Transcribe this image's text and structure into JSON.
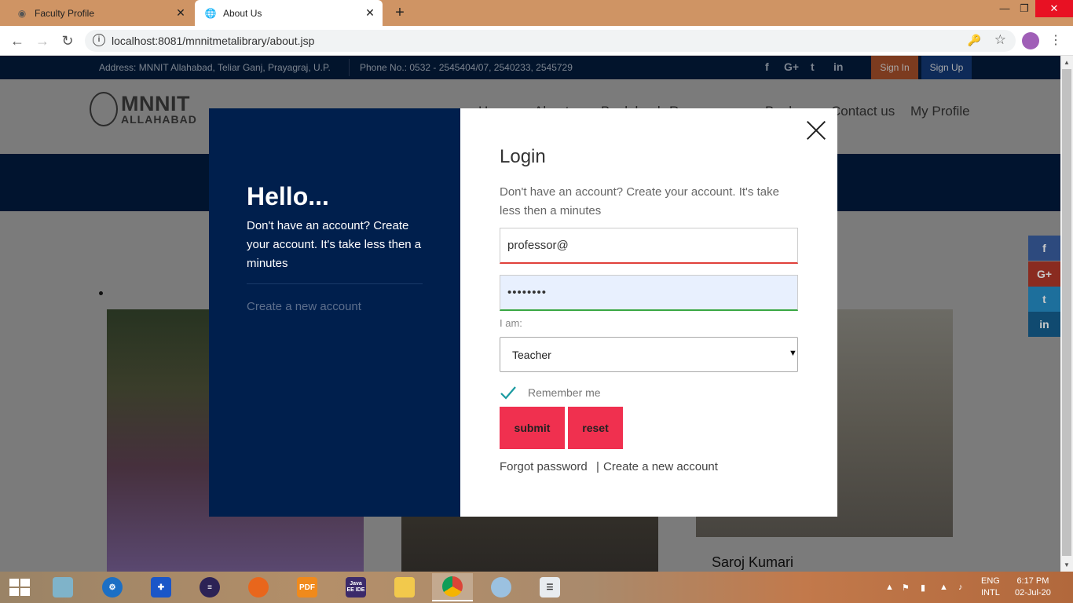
{
  "browser": {
    "tabs": [
      {
        "title": "Faculty Profile",
        "active": false
      },
      {
        "title": "About Us",
        "active": true
      }
    ],
    "new_tab_symbol": "+",
    "url": "localhost:8081/mnnitmetalibrary/about.jsp",
    "window_controls": {
      "minimize": "—",
      "maximize": "❐",
      "close": "✕"
    }
  },
  "site": {
    "top_strip": {
      "address": "Address: MNNIT Allahabad, Teliar Ganj, Prayagraj, U.P.",
      "phone": "Phone No.: 0532 - 2545404/07, 2540233, 2545729",
      "social": [
        "f",
        "G+",
        "t",
        "in"
      ],
      "sign_in": "Sign In",
      "sign_up": "Sign Up"
    },
    "logo": {
      "line1": "MNNIT",
      "line2": "ALLAHABAD"
    },
    "menu": [
      "Home",
      "About us",
      "Book bank",
      "Resources",
      "Books",
      "Contact us",
      "My Profile"
    ],
    "card3_name": "Saroj Kumari",
    "share_buttons": [
      "f",
      "G+",
      "t",
      "in"
    ],
    "colors": {
      "banner": "#01142f",
      "facebook": "#2d4a7e",
      "google": "#8a2b20",
      "twitter": "#1d6f9c",
      "linkedin": "#104a70"
    }
  },
  "modal": {
    "left": {
      "heading": "Hello...",
      "text": "Don't have an account? Create your account. It's take less then a minutes",
      "create_link": "Create a new account"
    },
    "right": {
      "title": "Login",
      "subtitle": "Don't have an account? Create your account. It's take less then a minutes",
      "email_value": "professor@",
      "password_value": "••••••••",
      "role_label": "I am:",
      "role_selected": "Teacher",
      "remember_label": "Remember me",
      "remember_checked": true,
      "submit_label": "submit",
      "reset_label": "reset",
      "forgot_link": "Forgot password",
      "separator": "|",
      "create_link": "Create a new account"
    },
    "accent_color": "#f0304f"
  },
  "taskbar": {
    "apps": [
      "file-icon",
      "network-icon",
      "security-shield-icon",
      "eclipse-icon",
      "firefox-icon",
      "pdf-icon",
      "java-ee-ide-icon",
      "file-explorer-icon",
      "chrome-icon",
      "paint-icon",
      "document-icon"
    ],
    "java_label": "Java EE IDE",
    "pdf_label": "PDF",
    "language": {
      "line1": "ENG",
      "line2": "INTL"
    },
    "time": "6:17 PM",
    "date": "02-Jul-20"
  }
}
